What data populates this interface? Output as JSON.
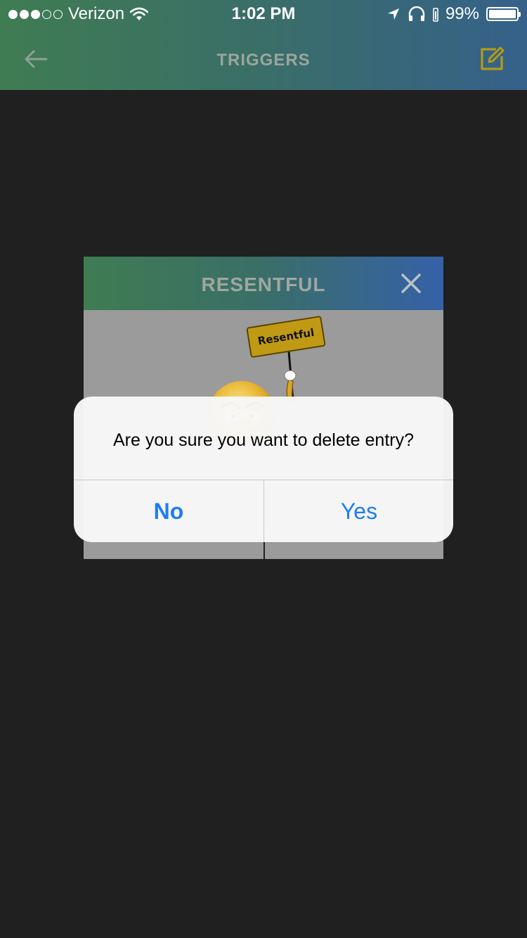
{
  "status_bar": {
    "carrier": "Verizon",
    "time": "1:02 PM",
    "battery": "99%",
    "signal_full": 3,
    "signal_total": 5
  },
  "nav": {
    "title": "TRIGGERS",
    "back_icon": "arrow-left-icon",
    "edit_icon": "edit-square-icon",
    "edit_color": "#b49a16"
  },
  "card": {
    "title": "RESENTFUL",
    "sign_text": "Resentful",
    "close_icon": "close-icon"
  },
  "alert": {
    "message": "Are you sure you want to delete entry?",
    "no_label": "No",
    "yes_label": "Yes"
  },
  "colors": {
    "background": "#202020",
    "header_green": "#3f7c52",
    "header_blue": "#35618a",
    "alert_button": "#1f7cf3"
  }
}
